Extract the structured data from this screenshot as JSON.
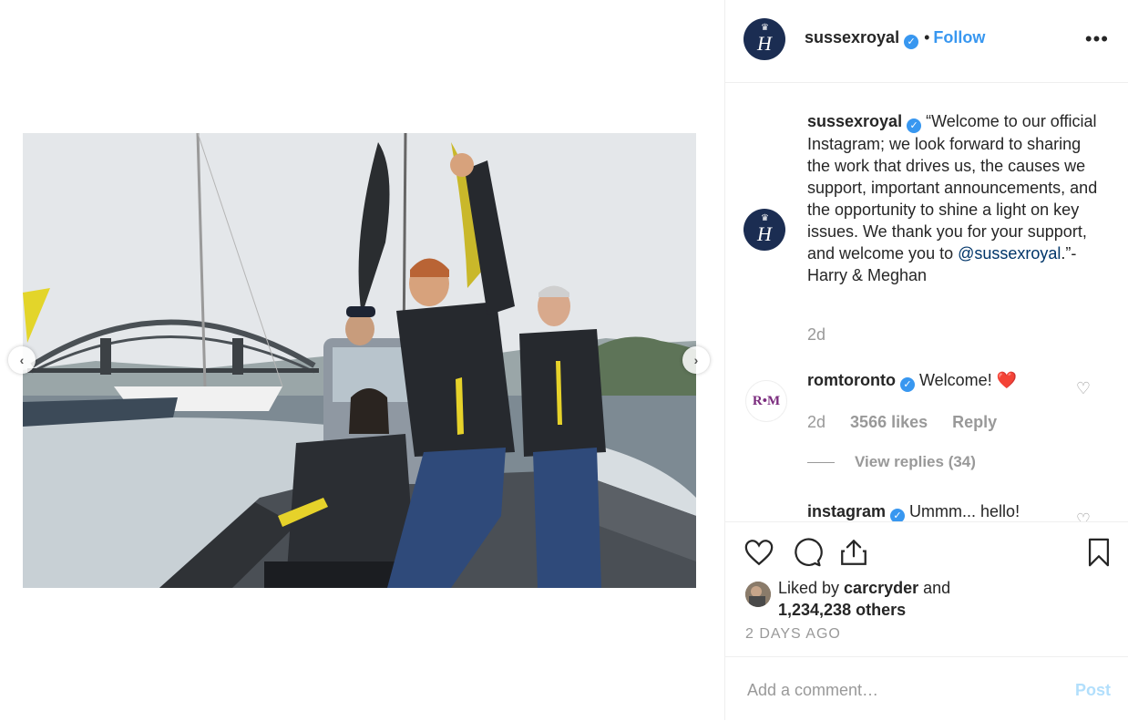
{
  "post": {
    "username": "sussexroyal",
    "follow_label": "Follow",
    "more_label": "•••",
    "avatar_monogram": "H",
    "photo_alt": ""
  },
  "caption": {
    "username": "sussexroyal",
    "text_before": "“Welcome to our official Instagram; we look forward to sharing the work that drives us, the causes we support, important announcements, and the opportunity to shine a light on key issues. We thank you for your support, and welcome you to ",
    "mention": "@sussexroyal",
    "text_after": ".”- Harry & Meghan",
    "time": "2d"
  },
  "comments": [
    {
      "username": "romtoronto",
      "avatar_text": "R•M",
      "text": "Welcome! ❤️",
      "time": "2d",
      "likes": "3566 likes",
      "reply_label": "Reply",
      "view_replies": "View replies (34)"
    },
    {
      "username": "instagram",
      "text": "Ummm... hello!"
    }
  ],
  "actions": {
    "liked_by_prefix": "Liked by ",
    "liked_by_user": "carcryder",
    "liked_by_suffix": " and",
    "others": "1,234,238 others",
    "date": "2 DAYS AGO"
  },
  "add_comment": {
    "placeholder": "Add a comment…",
    "post_label": "Post"
  },
  "icons": {
    "heart": "heart-icon",
    "comment": "comment-icon",
    "share": "share-icon",
    "bookmark": "bookmark-icon",
    "verified": "verified-badge-icon"
  },
  "colors": {
    "link": "#3897f0",
    "verified": "#3897f0",
    "avatar_bg": "#1b2d52",
    "muted": "#999999",
    "post_disabled": "#b2dffc"
  }
}
